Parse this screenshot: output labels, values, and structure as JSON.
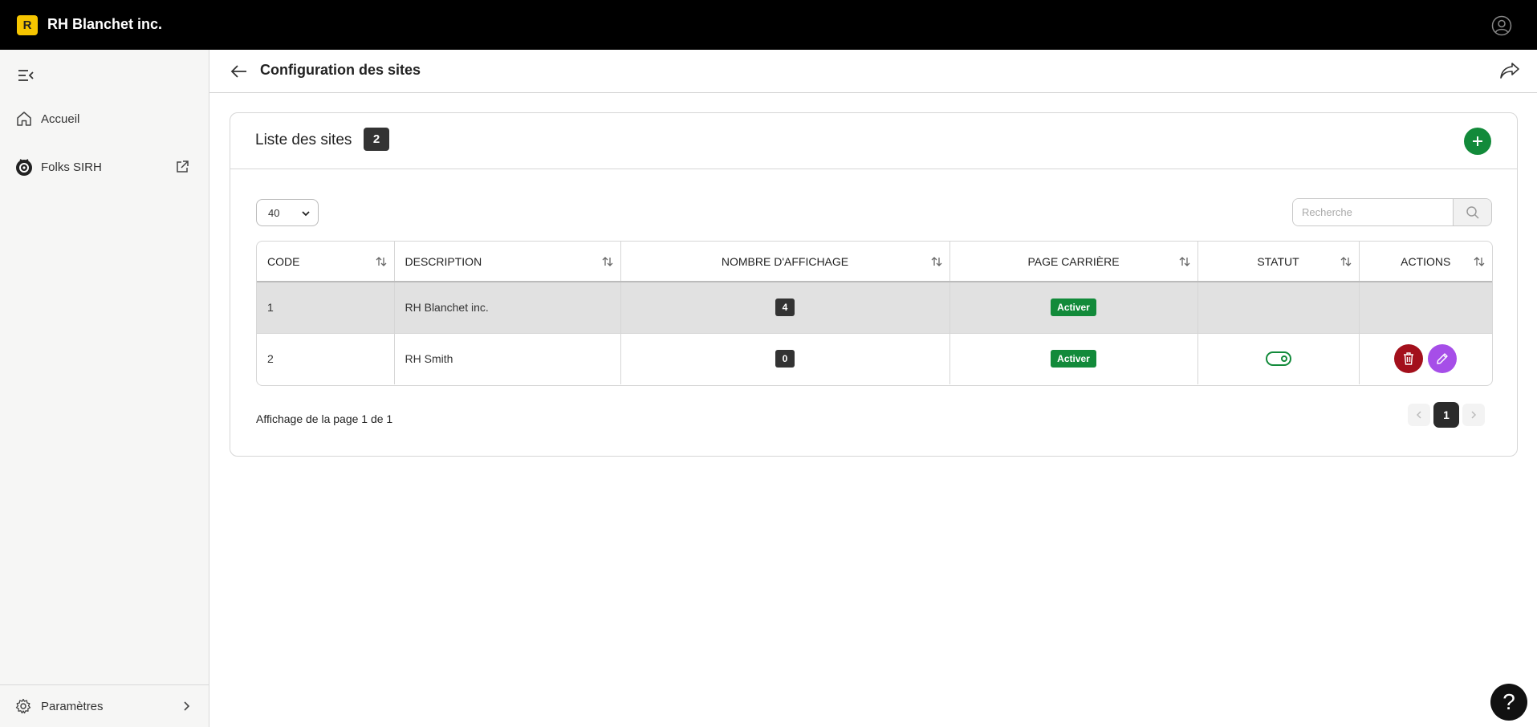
{
  "topbar": {
    "logo_letter": "R",
    "app_name": "RH Blanchet inc."
  },
  "sidebar": {
    "items": [
      {
        "label": "Accueil",
        "icon": "home-icon"
      },
      {
        "label": "Folks SIRH",
        "icon": "folks-logo-icon"
      }
    ],
    "settings_label": "Paramètres"
  },
  "header": {
    "title": "Configuration des sites"
  },
  "card": {
    "title": "Liste des sites",
    "count": "2",
    "per_page": "40",
    "search_placeholder": "Recherche",
    "columns": [
      "CODE",
      "DESCRIPTION",
      "NOMBRE D'AFFICHAGE",
      "PAGE CARRIÈRE",
      "STATUT",
      "ACTIONS"
    ],
    "rows": [
      {
        "code": "1",
        "description": "RH Blanchet inc.",
        "count": "4",
        "career_page": "Activer"
      },
      {
        "code": "2",
        "description": "RH Smith",
        "count": "0",
        "career_page": "Activer"
      }
    ],
    "page_info": "Affichage de la page 1 de 1",
    "current_page": "1"
  },
  "help": {
    "label": "?"
  },
  "colors": {
    "accent_green": "#128a3a",
    "danger_red": "#a3101c",
    "edit_purple": "#a64ee8",
    "logo_yellow": "#f6c500"
  }
}
